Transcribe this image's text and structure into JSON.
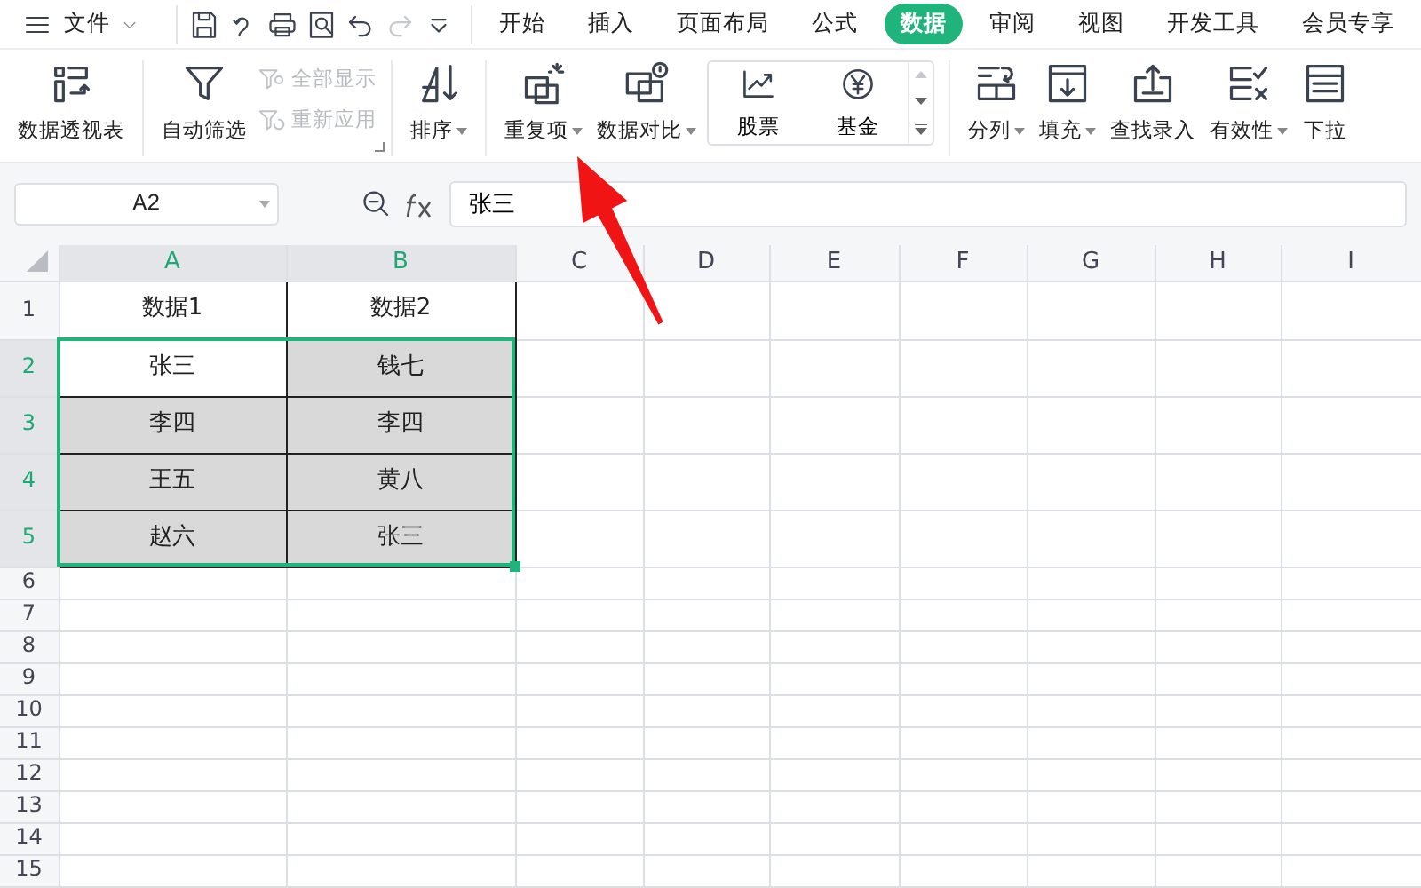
{
  "menu": {
    "label": "文件"
  },
  "tabs": [
    {
      "label": "开始",
      "selected": false
    },
    {
      "label": "插入",
      "selected": false
    },
    {
      "label": "页面布局",
      "selected": false
    },
    {
      "label": "公式",
      "selected": false
    },
    {
      "label": "数据",
      "selected": true
    },
    {
      "label": "审阅",
      "selected": false
    },
    {
      "label": "视图",
      "selected": false
    },
    {
      "label": "开发工具",
      "selected": false
    },
    {
      "label": "会员专享",
      "selected": false
    }
  ],
  "ribbon_groups": [
    {
      "items": [
        {
          "kind": "large",
          "label": "数据透视表",
          "dropdown": false
        }
      ]
    },
    {
      "items": [
        {
          "kind": "large",
          "label": "自动筛选",
          "dropdown": false
        },
        {
          "kind": "small",
          "label": "全部显示",
          "disabled": true
        },
        {
          "kind": "small",
          "label": "重新应用",
          "disabled": true
        }
      ]
    },
    {
      "items": [
        {
          "kind": "large",
          "label": "排序",
          "dropdown": true
        }
      ]
    },
    {
      "items": [
        {
          "kind": "large",
          "label": "重复项",
          "dropdown": true
        },
        {
          "kind": "large",
          "label": "数据对比",
          "dropdown": true
        },
        {
          "kind": "gallery",
          "entries": [
            "股票",
            "基金"
          ]
        }
      ]
    },
    {
      "items": [
        {
          "kind": "large",
          "label": "分列",
          "dropdown": true
        },
        {
          "kind": "large",
          "label": "填充",
          "dropdown": true
        },
        {
          "kind": "large",
          "label": "查找录入",
          "dropdown": false
        },
        {
          "kind": "large",
          "label": "有效性",
          "dropdown": true
        },
        {
          "kind": "large",
          "label": "下拉",
          "dropdown": false
        }
      ]
    }
  ],
  "name_box": "A2",
  "formula": "张三",
  "columns": [
    {
      "label": "A",
      "selected": true
    },
    {
      "label": "B",
      "selected": true
    },
    {
      "label": "C",
      "selected": false
    },
    {
      "label": "D",
      "selected": false
    },
    {
      "label": "E",
      "selected": false
    },
    {
      "label": "F",
      "selected": false
    },
    {
      "label": "G",
      "selected": false
    },
    {
      "label": "H",
      "selected": false
    },
    {
      "label": "I",
      "selected": false
    }
  ],
  "rows": [
    {
      "label": "1",
      "selected": false,
      "cells": [
        {
          "text": "数据1",
          "highlighted": false
        },
        {
          "text": "数据2",
          "highlighted": false
        }
      ]
    },
    {
      "label": "2",
      "selected": true,
      "cells": [
        {
          "text": "张三",
          "highlighted": false
        },
        {
          "text": "钱七",
          "highlighted": true
        }
      ]
    },
    {
      "label": "3",
      "selected": true,
      "cells": [
        {
          "text": "李四",
          "highlighted": true
        },
        {
          "text": "李四",
          "highlighted": true
        }
      ]
    },
    {
      "label": "4",
      "selected": true,
      "cells": [
        {
          "text": "王五",
          "highlighted": true
        },
        {
          "text": "黄八",
          "highlighted": true
        }
      ]
    },
    {
      "label": "5",
      "selected": true,
      "cells": [
        {
          "text": "赵六",
          "highlighted": true
        },
        {
          "text": "张三",
          "highlighted": true
        }
      ]
    },
    {
      "label": "6",
      "selected": false,
      "cells": []
    },
    {
      "label": "7",
      "selected": false,
      "cells": []
    },
    {
      "label": "8",
      "selected": false,
      "cells": []
    },
    {
      "label": "9",
      "selected": false,
      "cells": []
    },
    {
      "label": "10",
      "selected": false,
      "cells": []
    },
    {
      "label": "11",
      "selected": false,
      "cells": []
    },
    {
      "label": "12",
      "selected": false,
      "cells": []
    },
    {
      "label": "13",
      "selected": false,
      "cells": []
    },
    {
      "label": "14",
      "selected": false,
      "cells": []
    },
    {
      "label": "15",
      "selected": false,
      "cells": []
    }
  ]
}
